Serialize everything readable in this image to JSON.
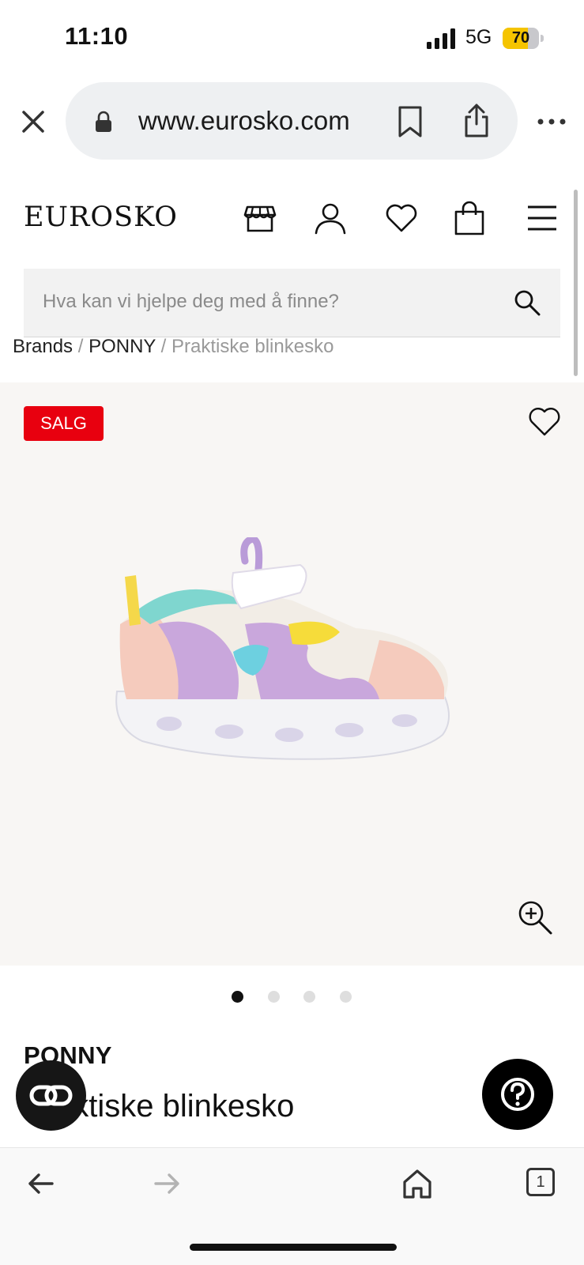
{
  "status_bar": {
    "time": "11:10",
    "network": "5G",
    "battery": "70",
    "battery_fraction": 0.7
  },
  "browser": {
    "url": "www.eurosko.com"
  },
  "site": {
    "logo": "EUROSKO",
    "search_placeholder": "Hva kan vi hjelpe deg med å finne?",
    "breadcrumb": [
      "Brands",
      "PONNY",
      "Praktiske blinkesko"
    ]
  },
  "product": {
    "badge": "SALG",
    "brand": "PONNY",
    "name": "Praktiske blinkesko",
    "name_visible": "ktiske blinkesko",
    "image_count": 4,
    "active_image": 1
  },
  "tabs": {
    "count": "1"
  },
  "colors": {
    "sale_red": "#e8000f",
    "battery_yellow": "#f5c400"
  }
}
